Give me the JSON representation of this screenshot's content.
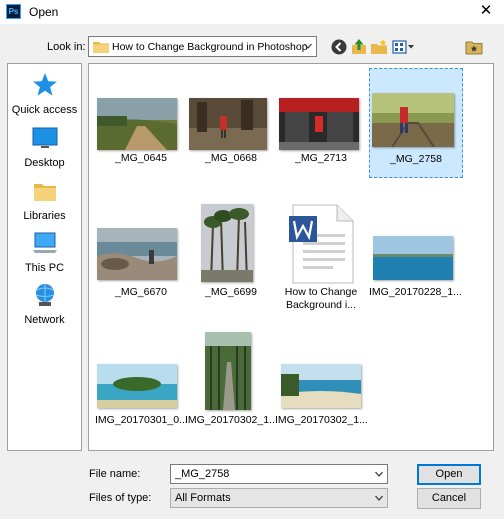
{
  "window": {
    "title": "Open",
    "close_glyph": "✕",
    "app_icon_text": "Ps"
  },
  "look_in": {
    "label": "Look in:",
    "value": "How to Change Background in Photoshop"
  },
  "places": [
    {
      "label": "Quick access",
      "icon": "star-icon"
    },
    {
      "label": "Desktop",
      "icon": "desktop-icon"
    },
    {
      "label": "Libraries",
      "icon": "libraries-icon"
    },
    {
      "label": "This PC",
      "icon": "computer-icon"
    },
    {
      "label": "Network",
      "icon": "network-icon"
    }
  ],
  "files": [
    {
      "label": "_MG_0645"
    },
    {
      "label": "_MG_0668"
    },
    {
      "label": "_MG_2713"
    },
    {
      "label": "_MG_2758",
      "selected": true
    },
    {
      "label": "_MG_6670"
    },
    {
      "label": "_MG_6699"
    },
    {
      "label": "How to Change Background i...",
      "type": "word-document-icon"
    },
    {
      "label": "IMG_20170228_1..."
    },
    {
      "label": "IMG_20170301_0..."
    },
    {
      "label": "IMG_20170302_1..."
    },
    {
      "label": "IMG_20170302_1..."
    }
  ],
  "file_name": {
    "label": "File name:",
    "value": "_MG_2758"
  },
  "file_type": {
    "label": "Files of type:",
    "value": "All Formats"
  },
  "buttons": {
    "open": "Open",
    "cancel": "Cancel"
  },
  "colors": {
    "selection": "#cce8ff",
    "selection_border": "#3d8fd8",
    "accent": "#0078d7"
  }
}
